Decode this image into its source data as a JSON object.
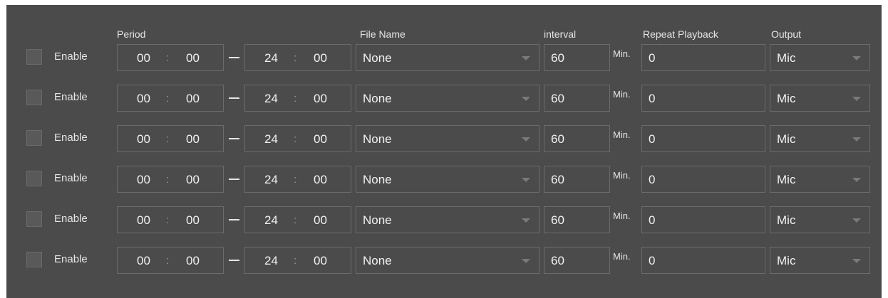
{
  "headers": {
    "period": "Period",
    "file_name": "File Name",
    "interval": "interval",
    "repeat_playback": "Repeat Playback",
    "output": "Output"
  },
  "rows": [
    {
      "enable_label": "Enable",
      "enabled": false,
      "start_hour": "00",
      "start_min": "00",
      "end_hour": "24",
      "end_min": "00",
      "file": "None",
      "interval": "60",
      "unit": "Min.",
      "repeat": "0",
      "output": "Mic"
    },
    {
      "enable_label": "Enable",
      "enabled": false,
      "start_hour": "00",
      "start_min": "00",
      "end_hour": "24",
      "end_min": "00",
      "file": "None",
      "interval": "60",
      "unit": "Min.",
      "repeat": "0",
      "output": "Mic"
    },
    {
      "enable_label": "Enable",
      "enabled": false,
      "start_hour": "00",
      "start_min": "00",
      "end_hour": "24",
      "end_min": "00",
      "file": "None",
      "interval": "60",
      "unit": "Min.",
      "repeat": "0",
      "output": "Mic"
    },
    {
      "enable_label": "Enable",
      "enabled": false,
      "start_hour": "00",
      "start_min": "00",
      "end_hour": "24",
      "end_min": "00",
      "file": "None",
      "interval": "60",
      "unit": "Min.",
      "repeat": "0",
      "output": "Mic"
    },
    {
      "enable_label": "Enable",
      "enabled": false,
      "start_hour": "00",
      "start_min": "00",
      "end_hour": "24",
      "end_min": "00",
      "file": "None",
      "interval": "60",
      "unit": "Min.",
      "repeat": "0",
      "output": "Mic"
    },
    {
      "enable_label": "Enable",
      "enabled": false,
      "start_hour": "00",
      "start_min": "00",
      "end_hour": "24",
      "end_min": "00",
      "file": "None",
      "interval": "60",
      "unit": "Min.",
      "repeat": "0",
      "output": "Mic"
    }
  ],
  "time_separator": ":",
  "colors": {
    "panel_background": "#4b4b4b",
    "field_border": "#6b6b6b",
    "text": "#e6e6e6"
  }
}
